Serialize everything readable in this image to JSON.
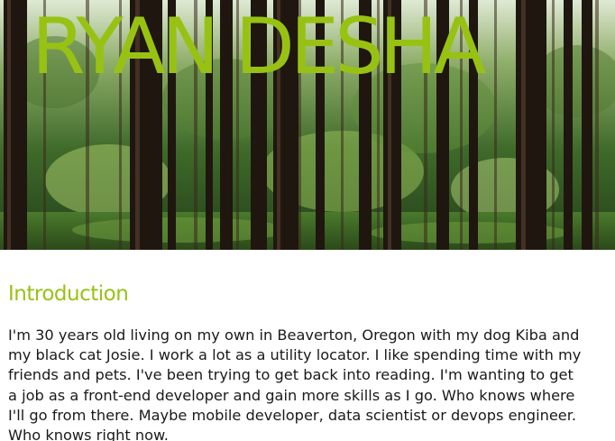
{
  "header": {
    "title": "RYAN DESHA",
    "background_image": "forest-trees-image"
  },
  "intro": {
    "heading": "Introduction",
    "paragraph": "I'm 30 years old living on my own in Beaverton, Oregon with my dog Kiba and my black cat Josie. I work a lot as a utility locator. I like spending time with my friends and pets. I've been trying to get back into reading. I'm wanting to get a job as a front-end developer and gain more skills as I go. Who knows where I'll go from there. Maybe mobile developer, data scientist or devops engineer. Who knows right now."
  },
  "colors": {
    "accent": "#98c213",
    "text": "#1a1a1a",
    "background": "#ffffff"
  }
}
